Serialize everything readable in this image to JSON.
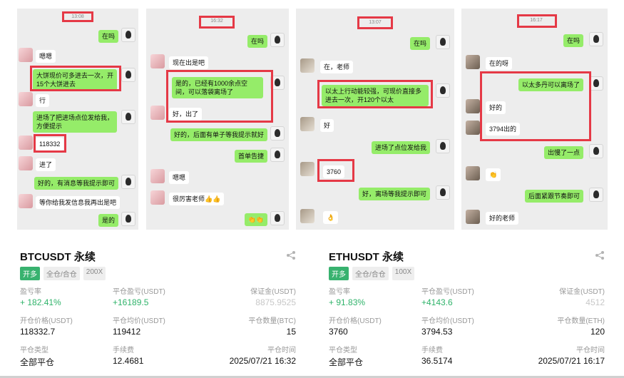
{
  "chats": [
    {
      "time": "13:08",
      "messages": [
        {
          "text": "在吗"
        },
        {
          "text": "嗯嗯"
        },
        {
          "text": "大饼现价可多进去一次，开15个大饼进去"
        },
        {
          "text": "行"
        },
        {
          "text": "进场了把进场点位发给我，方便提示"
        },
        {
          "text": "118332"
        },
        {
          "text": "进了"
        },
        {
          "text": "好的，有消息等我提示即可"
        },
        {
          "text": "等你给我发信息我再出是吧"
        },
        {
          "text": "是的"
        }
      ]
    },
    {
      "time": "16:32",
      "messages": [
        {
          "text": "在吗"
        },
        {
          "text": "现在出是吧"
        },
        {
          "text": "是的，已经有1000余点空间，可以落袋离场了"
        },
        {
          "text": "好，出了"
        },
        {
          "text": "好的，后面有单子等我提示就好"
        },
        {
          "text": "首单告捷"
        },
        {
          "text": "嗯嗯"
        },
        {
          "text": "很厉害老师👍👍"
        },
        {
          "text": "👏👏"
        }
      ]
    },
    {
      "time": "13:07",
      "messages": [
        {
          "text": "在吗"
        },
        {
          "text": "在，老师"
        },
        {
          "text": "以太上行动能较强，可现价直接多进去一次，开120个以太"
        },
        {
          "text": "好"
        },
        {
          "text": "进场了点位发给我"
        },
        {
          "text": "3760"
        },
        {
          "text": "好，离场等我提示即可"
        },
        {
          "text": "👌"
        }
      ]
    },
    {
      "time": "16:17",
      "messages": [
        {
          "text": "在吗"
        },
        {
          "text": "在的呀"
        },
        {
          "text": "以太多丹可以离场了"
        },
        {
          "text": "好的"
        },
        {
          "text": "3794出的"
        },
        {
          "text": "出慢了一点"
        },
        {
          "text": "👏"
        },
        {
          "text": "后面紧跟节奏即可"
        },
        {
          "text": "好的老师"
        }
      ]
    }
  ],
  "cards": [
    {
      "title": "BTCUSDT 永续",
      "tags": [
        "开多",
        "全仓/合仓",
        "200X"
      ],
      "pnl_rate_label": "盈亏率",
      "pnl_rate": "+ 182.41%",
      "close_pnl_label": "平仓盈亏(USDT)",
      "close_pnl": "+16189.5",
      "margin_label": "保证金(USDT)",
      "margin": "8875.9525",
      "open_price_label": "开仓价格(USDT)",
      "open_price": "118332.7",
      "close_avg_label": "平仓均价(USDT)",
      "close_avg": "119412",
      "close_qty_label": "平仓数量(BTC)",
      "close_qty": "15",
      "close_type_label": "平仓类型",
      "close_type": "全部平仓",
      "fee_label": "手续费",
      "fee": "12.4681",
      "close_time_label": "平仓时间",
      "close_time": "2025/07/21 16:32"
    },
    {
      "title": "ETHUSDT 永续",
      "tags": [
        "开多",
        "全仓/合仓",
        "100X"
      ],
      "pnl_rate_label": "盈亏率",
      "pnl_rate": "+ 91.83%",
      "close_pnl_label": "平仓盈亏(USDT)",
      "close_pnl": "+4143.6",
      "margin_label": "保证金(USDT)",
      "margin": "4512",
      "open_price_label": "开仓价格(USDT)",
      "open_price": "3760",
      "close_avg_label": "平仓均价(USDT)",
      "close_avg": "3794.53",
      "close_qty_label": "平仓数量(ETH)",
      "close_qty": "120",
      "close_type_label": "平仓类型",
      "close_type": "全部平仓",
      "fee_label": "手续费",
      "fee": "36.5174",
      "close_time_label": "平仓时间",
      "close_time": "2025/07/21 16:17"
    }
  ],
  "colors": {
    "highlight": "#e53946",
    "bubble_me": "#95ec69",
    "bubble_other": "#ffffff",
    "profit_green": "#2fb36a",
    "tag_long": "#38b26f"
  },
  "icons": {
    "share": "share-icon"
  }
}
